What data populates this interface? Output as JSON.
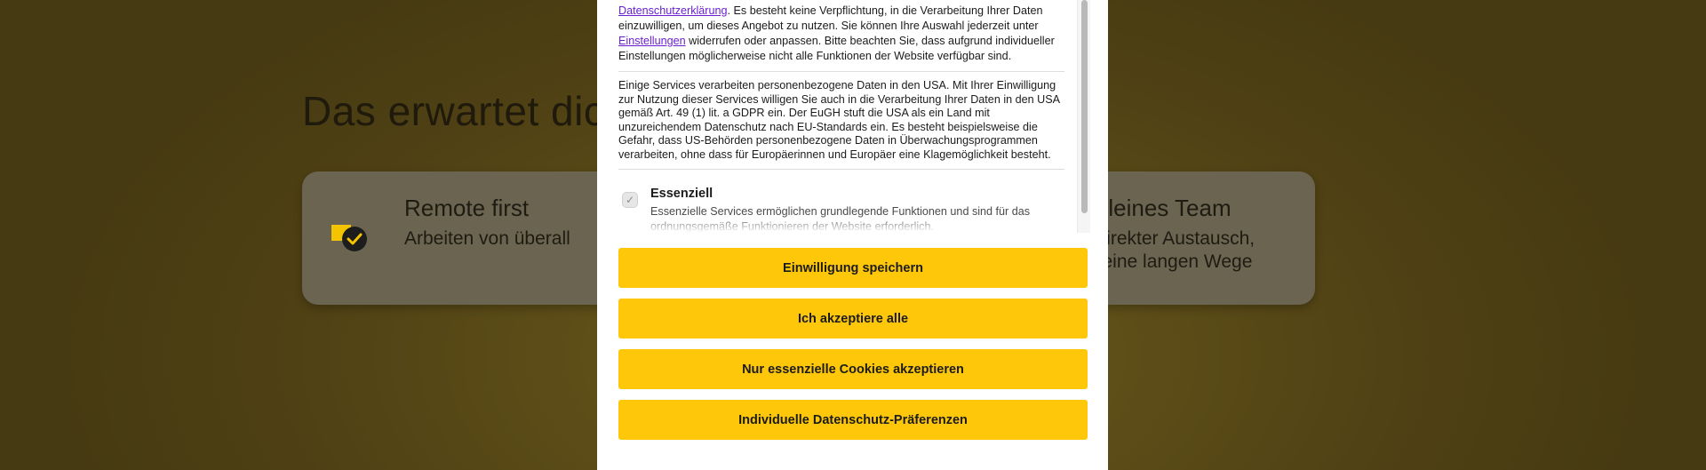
{
  "background": {
    "headline": "Das erwartet dich",
    "features": [
      {
        "icon": "checkmark-badge-icon",
        "title": "Remote first",
        "subtitle": "Arbeiten von überall"
      },
      {
        "title": "Kleines Team",
        "subtitle_line1": "Direkter Austausch,",
        "subtitle_line2": "keine langen Wege"
      }
    ],
    "icon_color": "#f5c400"
  },
  "modal": {
    "para1": {
      "link1": "Datenschutzerklärung",
      "text1": ". Es besteht keine Verpflichtung, in die Verarbeitung Ihrer Daten einzuwilligen, um dieses Angebot zu nutzen. Sie können Ihre Auswahl jederzeit unter ",
      "link2": "Einstellungen",
      "text2": " widerrufen oder anpassen. Bitte beachten Sie, dass aufgrund individueller Einstellungen möglicherweise nicht alle Funktionen der Website verfügbar sind."
    },
    "para2": "Einige Services verarbeiten personenbezogene Daten in den USA. Mit Ihrer Einwilligung zur Nutzung dieser Services willigen Sie auch in die Verarbeitung Ihrer Daten in den USA gemäß Art. 49 (1) lit. a GDPR ein. Der EuGH stuft die USA als ein Land mit unzureichendem Datenschutz nach EU-Standards ein. Es besteht beispielsweise die Gefahr, dass US-Behörden personenbezogene Daten in Überwachungsprogrammen verarbeiten, ohne dass für Europäerinnen und Europäer eine Klagemöglichkeit besteht.",
    "group": {
      "title": "Essenziell",
      "description": "Essenzielle Services ermöglichen grundlegende Funktionen und sind für das ordnungsgemäße Funktionieren der Website erforderlich.",
      "check_glyph": "✓"
    },
    "buttons": {
      "save": "Einwilligung speichern",
      "accept_all": "Ich akzeptiere alle",
      "essential_only": "Nur essenzielle Cookies akzeptieren",
      "preferences": "Individuelle Datenschutz-Präferenzen"
    },
    "accent_color": "#fec70a",
    "link_color": "#6a1fd1"
  }
}
